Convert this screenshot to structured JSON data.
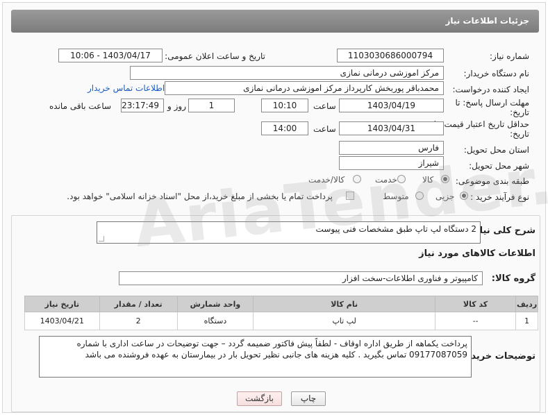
{
  "header": {
    "title": "جزئیات اطلاعات نیاز"
  },
  "form": {
    "need_number_label": "شماره نیاز:",
    "need_number": "1103030686000794",
    "announce_label": "تاریخ و ساعت اعلان عمومی:",
    "announce_value": "1403/04/17 - 10:06",
    "buyer_org_label": "نام دستگاه خریدار:",
    "buyer_org": "مرکز اموزشی درمانی نمازی",
    "creator_label": "ایجاد کننده درخواست:",
    "creator": "محمدباقر پوربخش کارپرداز مرکز اموزشی درمانی نمازی",
    "contact_link": "اطلاعات تماس خریدار",
    "deadline_label_1": "مهلت ارسال پاسخ: تا",
    "deadline_label_2": "تاریخ:",
    "deadline_date": "1403/04/19",
    "time_label": "ساعت",
    "deadline_time": "10:10",
    "days_value": "1",
    "days_label": "روز و",
    "remaining_time": "23:17:49",
    "remaining_label": "ساعت باقی مانده",
    "validity_label_1": "حداقل تاریخ اعتبار قیمت: تا",
    "validity_label_2": "تاریخ:",
    "validity_date": "1403/04/31",
    "validity_time": "14:00",
    "province_label": "استان محل تحویل:",
    "province": "فارس",
    "city_label": "شهر محل تحویل:",
    "city": "شیراز",
    "category_label": "طبقه بندی موضوعی:",
    "category_options": [
      "کالا",
      "خدمت",
      "کالا/خدمت"
    ],
    "category_selected": "کالا",
    "process_label": "نوع فرآیند خرید :",
    "process_options": [
      "جزیی",
      "متوسط"
    ],
    "process_selected": "جزیی",
    "payment_note": "پرداخت تمام یا بخشی از مبلغ خرید،از محل \"اسناد خزانه اسلامی\" خواهد بود."
  },
  "details": {
    "description_label": "شرح کلی نیاز:",
    "description": "2 دستگاه لپ تاپ طبق مشخصات فنی پیوست",
    "goods_info_title": "اطلاعات کالاهای مورد نیاز",
    "goods_group_label": "گروه کالا:",
    "goods_group": "کامپیوتر و فناوری اطلاعات-سخت افزار",
    "table": {
      "headers": [
        "ردیف",
        "کد کالا",
        "نام کالا",
        "واحد شمارش",
        "تعداد / مقدار",
        "تاریخ نیاز"
      ],
      "rows": [
        [
          "1",
          "--",
          "لپ تاپ",
          "دستگاه",
          "2",
          "1403/04/21"
        ]
      ]
    },
    "buyer_notes_label": "توضیحات خریدار:",
    "buyer_notes": "پرداخت یکماهه از طریق اداره اوقاف - لطفاً پیش فاکتور ضمیمه گردد – جهت توضیحات در ساعت اداری با شماره 09177087059 تماس بگیرید . کلیه هزینه های جانبی نظیر تحویل بار در بیمارستان به عهده فروشنده می باشد"
  },
  "buttons": {
    "print": "چاپ",
    "back": "بازگشت"
  },
  "watermark": "AriaTender.neT"
}
